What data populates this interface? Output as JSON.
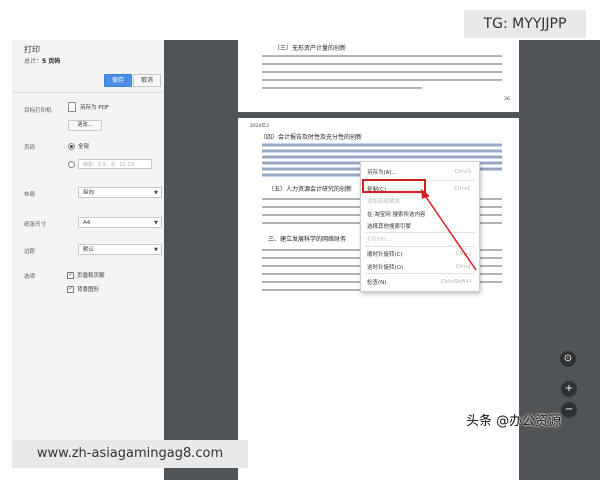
{
  "watermark": {
    "top": "TG: MYYJJPP",
    "bottom": "www.zh-asiagamingag8.com"
  },
  "source_label": "头条 @办公资源",
  "print_panel": {
    "title": "打印",
    "total_label": "总计：",
    "total_value": "5 页码",
    "save_button": "保存",
    "cancel_button": "取消",
    "destination_label": "目标打印机",
    "destination_value": "另存为 PDF",
    "change_button": "更改...",
    "pages_label": "页码",
    "pages_all": "全部",
    "pages_placeholder": "例如：1-5、8、11-13",
    "layout_label": "布局",
    "layout_value": "纵向",
    "paper_label": "纸张尺寸",
    "paper_value": "A4",
    "margin_label": "边距",
    "margin_value": "默认",
    "options_label": "选项",
    "option_headers": "页眉和页脚",
    "option_background": "背景图形"
  },
  "document": {
    "page1_heading": "（三）无形资产计量的创新",
    "page1_number": "36",
    "page2_header_tag": "2020年3",
    "page2_heading1": "（四）会计报告及时性及充分性的创新",
    "page2_heading2": "（五）人力资源会计研究的创新",
    "page2_heading3": "三、建立发展科学的网络财务"
  },
  "context_menu": {
    "items": [
      {
        "label": "另存为(A)...",
        "shortcut": "Ctrl+S"
      },
      {
        "label": "复制(C)",
        "shortcut": "Ctrl+C"
      },
      {
        "label": "添加到收藏夹",
        "shortcut": ""
      },
      {
        "label": "在 淘宝网 搜索所选内容",
        "shortcut": ""
      },
      {
        "label": "选择其他搜索引擎",
        "shortcut": ""
      },
      {
        "label": "打印(P)...",
        "shortcut": ""
      },
      {
        "label": "顺时针旋转(C)",
        "shortcut": "Ctrl+]"
      },
      {
        "label": "逆时针旋转(O)",
        "shortcut": "Ctrl+["
      },
      {
        "label": "检查(N)",
        "shortcut": "Ctrl+Shift+I"
      }
    ]
  },
  "viewer_controls": {
    "fit": "⊙",
    "zoom_in": "+",
    "zoom_out": "−"
  },
  "colors": {
    "highlight_box": "#d71d24",
    "primary_button": "#4d8fe6",
    "viewer_bg": "#515457"
  }
}
